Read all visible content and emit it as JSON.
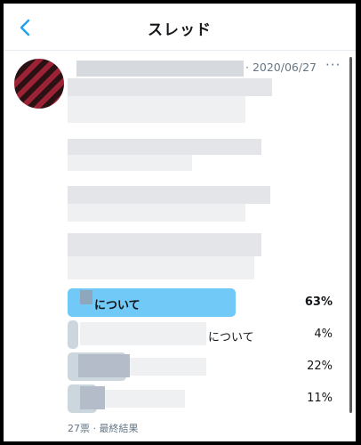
{
  "header": {
    "title": "スレッド"
  },
  "tweet": {
    "date": "· 2020/06/27",
    "more": "···"
  },
  "poll": {
    "options": [
      {
        "label": "について",
        "percent": "63%",
        "share": 0.63,
        "winner": true
      },
      {
        "label": "について",
        "percent": "4%",
        "share": 0.04,
        "winner": false
      },
      {
        "label": "",
        "percent": "22%",
        "share": 0.22,
        "winner": false
      },
      {
        "label": "",
        "percent": "11%",
        "share": 0.11,
        "winner": false
      }
    ],
    "footer": "27票 · 最終結果"
  },
  "colors": {
    "accent": "#1da1f2",
    "winner_bar": "#71c9f8",
    "bar": "#ccd6dd"
  }
}
